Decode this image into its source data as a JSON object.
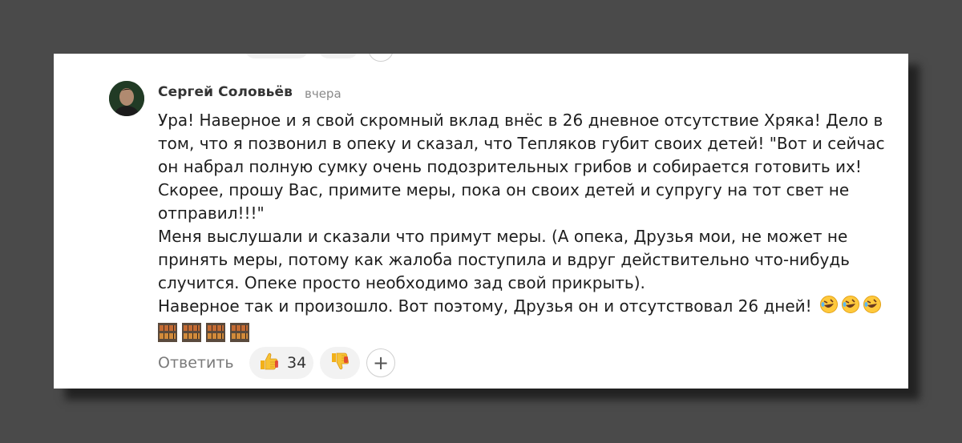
{
  "comment": {
    "author": "Сергей Соловьёв",
    "time": "вчера",
    "lines": [
      "Ура! Наверное и я свой скромный вклад внёс в 26 дневное отсутствие Хряка! Дело в",
      "том, что я позвонил в опеку и сказал, что Тепляков губит своих детей! \"Вот и сейчас",
      "он набрал полную сумку очень подозрительных грибов и собирается готовить их!",
      "Скорее, прошу Вас, примите меры, пока он своих детей и супругу на тот свет не",
      "отправил!!!\"",
      "Меня выслушали и сказали что примут меры. (А опека, Друзья мои, не может не",
      "принять меры, потому как жалоба поступила и вдруг действительно что-нибудь",
      "случится. Опеке просто необходимо зад свой прикрыть).",
      "Наверное так и произошло. Вот поэтому, Друзья он и отсутствовал 26 дней!"
    ],
    "emoji_after_last_line": [
      "rolling-laughing-emoji",
      "rolling-laughing-emoji",
      "rolling-laughing-emoji"
    ],
    "brick_emoji": [
      "brick-emoji",
      "brick-emoji",
      "brick-emoji",
      "brick-emoji"
    ]
  },
  "actions": {
    "reply_label": "Ответить",
    "like_count": "34",
    "like_icon": "thumbs-up-icon",
    "dislike_icon": "thumbs-down-icon",
    "add_reaction_label": "+"
  },
  "colors": {
    "page_bg": "#4a4a4a",
    "card_bg": "#ffffff",
    "pill_bg": "#f2f2f2",
    "thumb_yellow": "#f2b019"
  }
}
